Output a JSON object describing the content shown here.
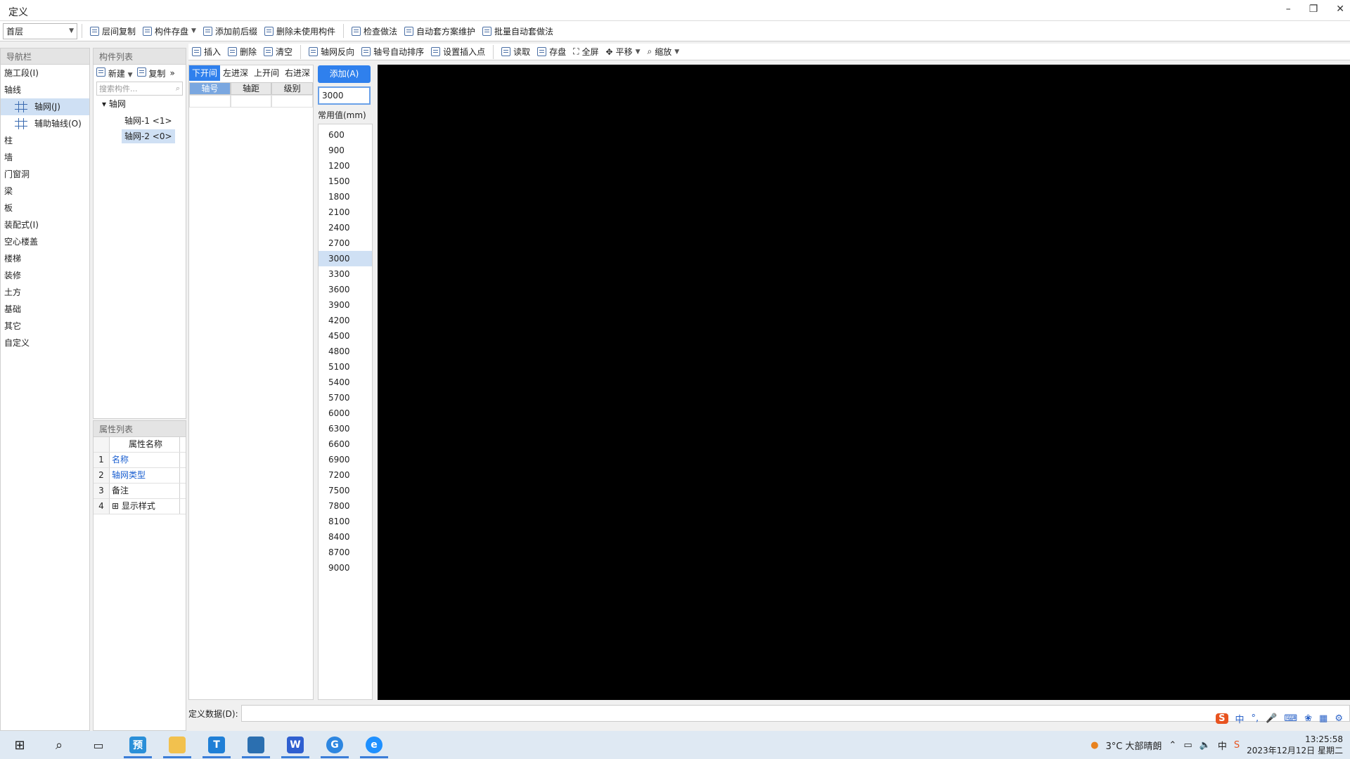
{
  "window": {
    "title": "定义"
  },
  "toolbar1": {
    "floor": "首层",
    "buttons": [
      "层间复制",
      "构件存盘",
      "添加前后缀",
      "删除未使用构件",
      "检查做法",
      "自动套方案维护",
      "批量自动套做法"
    ]
  },
  "nav": {
    "header": "导航栏",
    "items": [
      "施工段(I)",
      "轴线",
      "柱",
      "墙",
      "门窗洞",
      "梁",
      "板",
      "装配式(I)",
      "空心楼盖",
      "楼梯",
      "装修",
      "土方",
      "基础",
      "其它",
      "自定义"
    ],
    "sub": [
      "轴网(J)",
      "辅助轴线(O)"
    ]
  },
  "complist": {
    "header": "构件列表",
    "new_label": "新建",
    "copy_label": "复制",
    "search_placeholder": "搜索构件...",
    "root": "轴网",
    "leaves": [
      "轴网-1 <1>",
      "轴网-2 <0>"
    ]
  },
  "props": {
    "header": "属性列表",
    "col_name": "属性名称",
    "rows": [
      {
        "num": "1",
        "name": "名称"
      },
      {
        "num": "2",
        "name": "轴网类型"
      },
      {
        "num": "3",
        "name": "备注"
      },
      {
        "num": "4",
        "name": "显示样式"
      }
    ]
  },
  "toolbar2": {
    "buttons": [
      "插入",
      "删除",
      "清空",
      "轴网反向",
      "轴号自动排序",
      "设置插入点",
      "读取",
      "存盘",
      "全屏",
      "平移",
      "缩放"
    ]
  },
  "axis": {
    "tabs": [
      "下开间",
      "左进深",
      "上开间",
      "右进深"
    ],
    "columns": [
      "轴号",
      "轴距",
      "级别"
    ]
  },
  "add_button": "添加(A)",
  "input_value": "3000",
  "common_label": "常用值(mm)",
  "common_values": [
    "600",
    "900",
    "1200",
    "1500",
    "1800",
    "2100",
    "2400",
    "2700",
    "3000",
    "3300",
    "3600",
    "3900",
    "4200",
    "4500",
    "4800",
    "5100",
    "5400",
    "5700",
    "6000",
    "6300",
    "6600",
    "6900",
    "7200",
    "7500",
    "7800",
    "8100",
    "8400",
    "8700",
    "9000"
  ],
  "def_label": "定义数据(D):",
  "ime": {
    "s": "S",
    "lang": "中"
  },
  "tray": {
    "weather": "3°C 大部晴朗",
    "time": "13:25:58",
    "date": "2023年12月12日 星期二"
  },
  "colors": {
    "accent": "#2f80ed",
    "selection": "#cfe0f4",
    "canvas": "#000000"
  }
}
